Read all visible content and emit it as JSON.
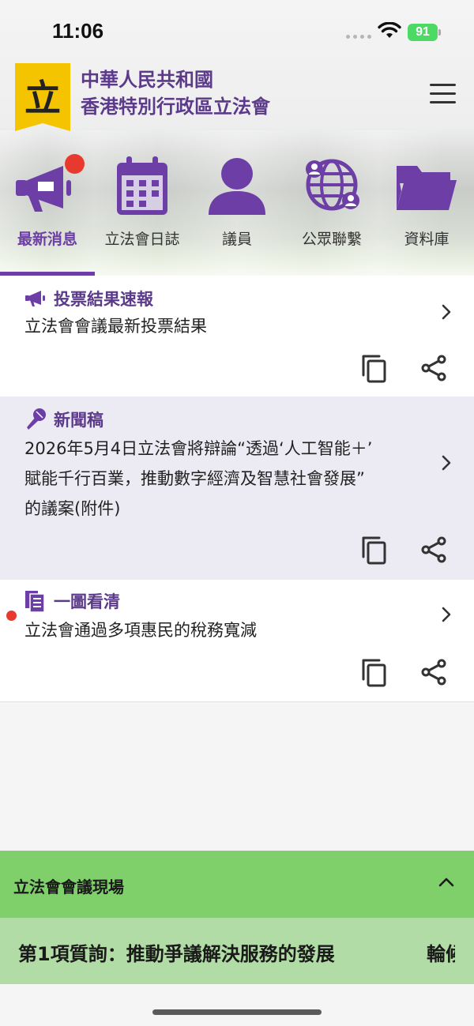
{
  "status_bar": {
    "time": "11:06",
    "battery": "91"
  },
  "header": {
    "logo_char": "立",
    "org_line1": "中華人民共和國",
    "org_line2": "香港特別行政區立法會"
  },
  "tabs": [
    {
      "label": "最新消息",
      "icon": "megaphone-icon",
      "active": true
    },
    {
      "label": "立法會日誌",
      "icon": "calendar-icon",
      "active": false
    },
    {
      "label": "議員",
      "icon": "person-icon",
      "active": false
    },
    {
      "label": "公眾聯繫",
      "icon": "globe-people-icon",
      "active": false
    },
    {
      "label": "資料庫",
      "icon": "folder-icon",
      "active": false
    }
  ],
  "cards": [
    {
      "title": "投票結果速報",
      "icon": "megaphone-icon",
      "body": [
        "立法會會議最新投票結果"
      ]
    },
    {
      "title": "新聞稿",
      "icon": "microphone-icon",
      "body": [
        "2026年5月4日立法會將辯論“透過‘人工智能＋’",
        "賦能千行百業，推動數字經濟及智慧社會發展”",
        "的議案(附件)"
      ]
    },
    {
      "title": "一圖看清",
      "icon": "documents-icon",
      "body": [
        "立法會通過多項惠民的稅務寬減"
      ]
    }
  ],
  "live": {
    "title": "立法會會議現場",
    "ticker": "第1項質詢：推動爭議解決服務的發展",
    "ticker_next": "輪候"
  },
  "colors": {
    "brand_purple": "#5c3a8a",
    "accent_purple": "#6d3fa6",
    "notification_red": "#e8392f",
    "live_green": "#7fcf6b",
    "ticker_green": "#b2dca6",
    "logo_yellow": "#f5c400"
  }
}
